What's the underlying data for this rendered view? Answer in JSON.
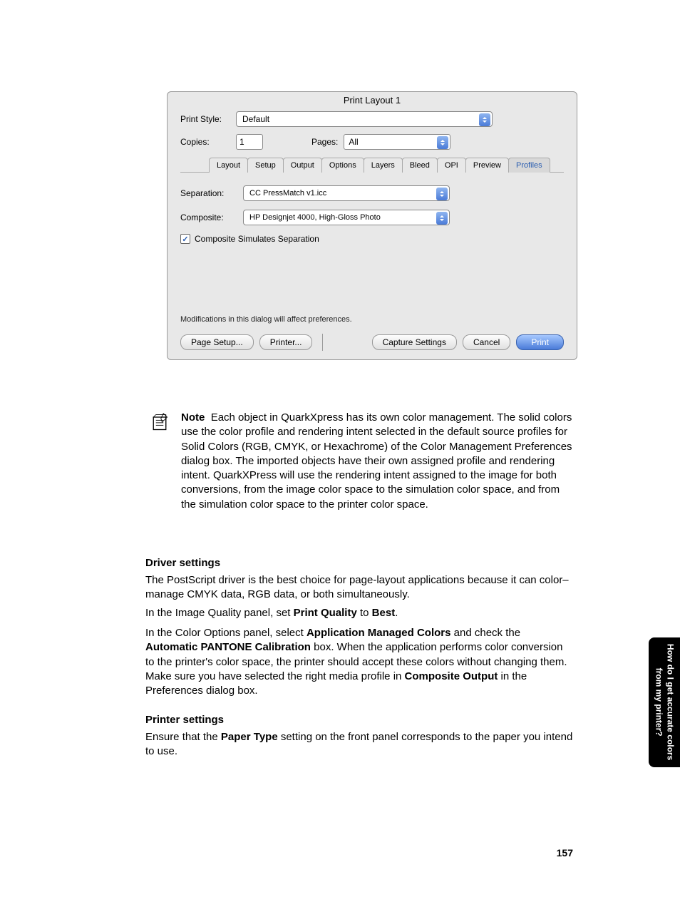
{
  "dialog": {
    "title": "Print Layout 1",
    "print_style_label": "Print Style:",
    "print_style_value": "Default",
    "copies_label": "Copies:",
    "copies_value": "1",
    "pages_label": "Pages:",
    "pages_value": "All",
    "tabs": [
      "Layout",
      "Setup",
      "Output",
      "Options",
      "Layers",
      "Bleed",
      "OPI",
      "Preview",
      "Profiles"
    ],
    "active_tab": "Profiles",
    "separation_label": "Separation:",
    "separation_value": "CC PressMatch v1.icc",
    "composite_label": "Composite:",
    "composite_value": "HP Designjet 4000, High-Gloss Photo",
    "checkbox_label": "Composite Simulates Separation",
    "footnote": "Modifications in this dialog will affect preferences.",
    "buttons": {
      "page_setup": "Page Setup...",
      "printer": "Printer...",
      "capture": "Capture Settings",
      "cancel": "Cancel",
      "print": "Print"
    }
  },
  "note": {
    "label": "Note",
    "text": "Each object in QuarkXpress has its own color management. The solid colors use the color profile and rendering intent selected in the default source profiles for Solid Colors (RGB, CMYK, or Hexachrome) of the Color Management Preferences dialog box. The imported objects have their own assigned profile and rendering intent. QuarkXPress will use the rendering intent assigned to the image for both conversions, from the image color space to the simulation color space, and from the simulation color space to the printer color space."
  },
  "driver": {
    "heading": "Driver settings",
    "p1": "The PostScript driver is the best choice for page-layout applications because it can color–manage CMYK data, RGB data, or both simultaneously.",
    "p2_a": "In the Image Quality panel, set ",
    "p2_b1": "Print Quality",
    "p2_c": " to ",
    "p2_b2": "Best",
    "p2_d": ".",
    "p3_a": "In the Color Options panel, select ",
    "p3_b1": "Application Managed Colors",
    "p3_c": " and check the ",
    "p3_b2": "Automatic PANTONE Calibration",
    "p3_d": " box. When the application performs color conversion to the printer's color space, the printer should accept these colors without changing them. Make sure you have selected the right media profile in ",
    "p3_b3": "Composite Output",
    "p3_e": " in the Preferences dialog box."
  },
  "printer": {
    "heading": "Printer settings",
    "p1_a": "Ensure that the ",
    "p1_b": "Paper Type",
    "p1_c": " setting on the front panel corresponds to the paper you intend to use."
  },
  "side_tab": {
    "line1": "How do I get accurate colors",
    "line2": "from my printer?"
  },
  "page_number": "157"
}
